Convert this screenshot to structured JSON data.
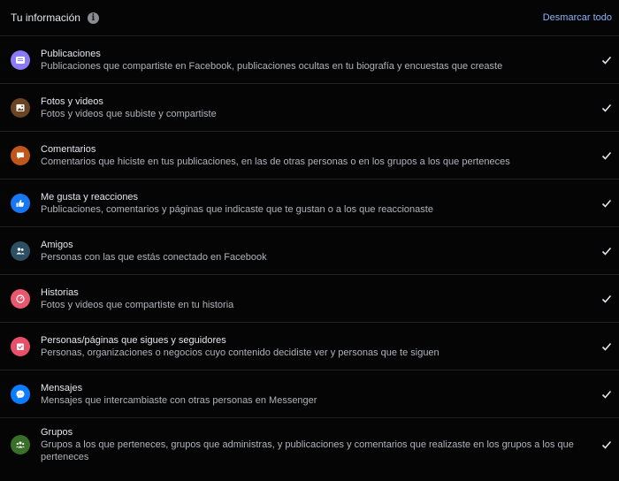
{
  "header": {
    "title": "Tu información",
    "info_icon": "info-icon",
    "unmark_label": "Desmarcar todo"
  },
  "items": [
    {
      "title": "Publicaciones",
      "desc": "Publicaciones que compartiste en Facebook, publicaciones ocultas en tu biografía y encuestas que creaste",
      "icon": "posts-icon",
      "color": "#8b7cf6",
      "checked": true
    },
    {
      "title": "Fotos y videos",
      "desc": "Fotos y videos que subiste y compartiste",
      "icon": "photos-icon",
      "color": "#6b4423",
      "checked": true
    },
    {
      "title": "Comentarios",
      "desc": "Comentarios que hiciste en tus publicaciones, en las de otras personas o en los grupos a los que perteneces",
      "icon": "comments-icon",
      "color": "#c0561a",
      "checked": true
    },
    {
      "title": "Me gusta y reacciones",
      "desc": "Publicaciones, comentarios y páginas que indicaste que te gustan o a los que reaccionaste",
      "icon": "like-icon",
      "color": "#1877f2",
      "checked": true
    },
    {
      "title": "Amigos",
      "desc": "Personas con las que estás conectado en Facebook",
      "icon": "friends-icon",
      "color": "#2c4f63",
      "checked": true
    },
    {
      "title": "Historias",
      "desc": "Fotos y videos que compartiste en tu historia",
      "icon": "stories-icon",
      "color": "#e8586e",
      "checked": true
    },
    {
      "title": "Personas/páginas que sigues y seguidores",
      "desc": "Personas, organizaciones o negocios cuyo contenido decidiste ver y personas que te siguen",
      "icon": "following-icon",
      "color": "#e8506a",
      "checked": true
    },
    {
      "title": "Mensajes",
      "desc": "Mensajes que intercambiaste con otras personas en Messenger",
      "icon": "messenger-icon",
      "color": "#0a7cff",
      "checked": true
    },
    {
      "title": "Grupos",
      "desc": "Grupos a los que perteneces, grupos que administras, y publicaciones y comentarios que realizaste en los grupos a los que perteneces",
      "icon": "groups-icon",
      "color": "#3a6f2a",
      "checked": true
    }
  ]
}
